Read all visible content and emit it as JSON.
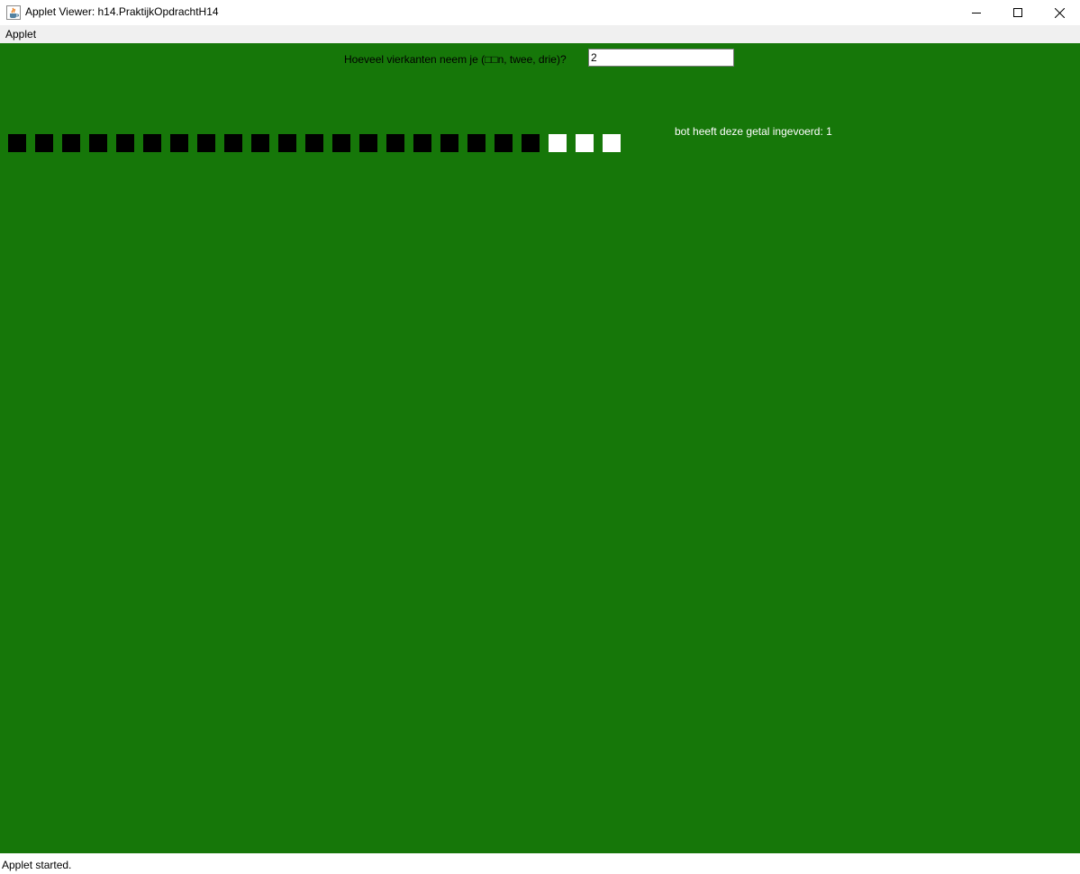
{
  "window": {
    "title": "Applet Viewer: h14.PraktijkOpdrachtH14",
    "app_icon": "java-cup-icon",
    "controls": {
      "minimize_icon": "minimize-icon",
      "maximize_icon": "maximize-icon",
      "close_icon": "close-icon"
    }
  },
  "menubar": {
    "items": [
      {
        "label": "Applet"
      }
    ]
  },
  "applet": {
    "background_color": "#167709",
    "question": "Hoeveel vierkanten neem je (□□n, twee, drie)?",
    "answer_value": "2",
    "bot_message": "bot heeft deze getal ingevoerd: 1",
    "squares": {
      "total": 23,
      "black_count": 20,
      "white_count": 3,
      "black_color": "#000000",
      "white_color": "#ffffff"
    }
  },
  "statusbar": {
    "text": "Applet started."
  }
}
